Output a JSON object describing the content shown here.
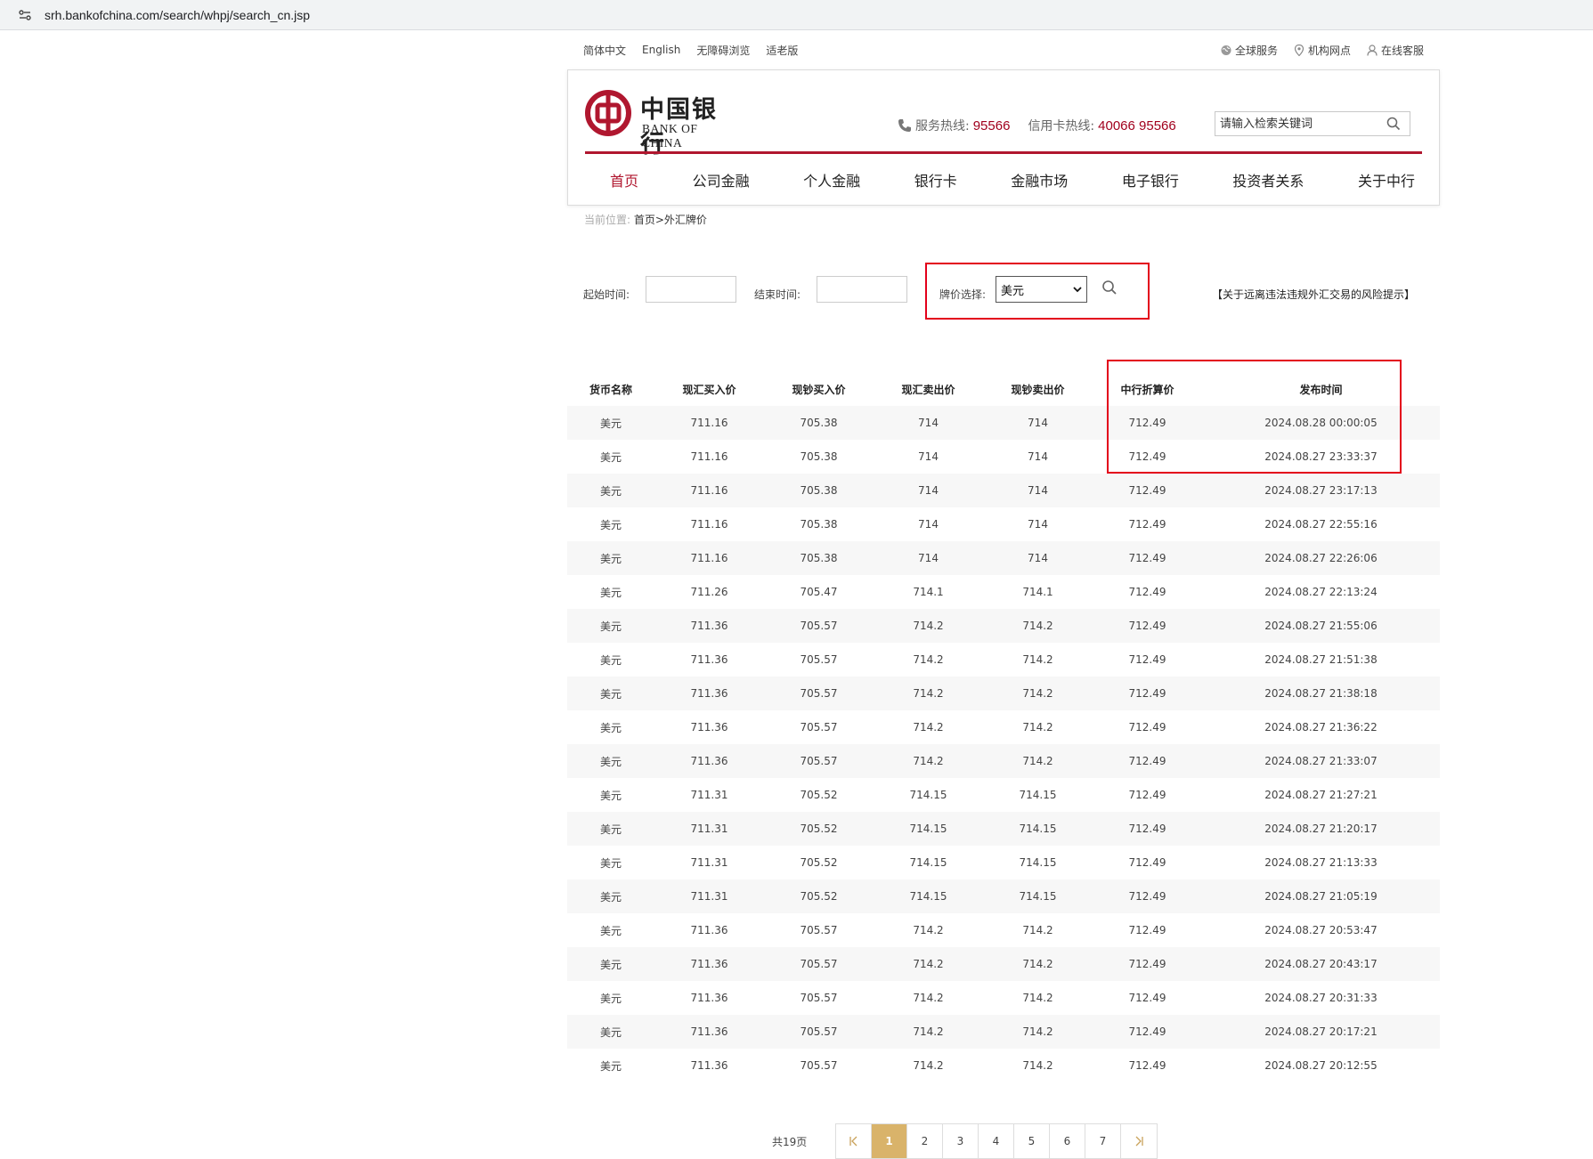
{
  "browser": {
    "url": "srh.bankofchina.com/search/whpj/search_cn.jsp"
  },
  "topbar": {
    "left": [
      "简体中文",
      "English",
      "无障碍浏览",
      "适老版"
    ],
    "global": "全球服务",
    "branches": "机构网点",
    "service": "在线客服"
  },
  "header": {
    "logo_cn": "中国银行",
    "logo_en": "BANK OF CHINA",
    "hotline_label": "服务热线:",
    "hotline": "95566",
    "credit_label": "信用卡热线:",
    "credit": "40066 95566",
    "search_placeholder": "请输入检索关键词",
    "brand_color": "#b0172f"
  },
  "nav": [
    "首页",
    "公司金融",
    "个人金融",
    "银行卡",
    "金融市场",
    "电子银行",
    "投资者关系",
    "关于中行"
  ],
  "breadcrumb": {
    "label": "当前位置:",
    "path": "首页>外汇牌价"
  },
  "filter": {
    "start_label": "起始时间:",
    "end_label": "结束时间:",
    "currency_label": "牌价选择:",
    "currency_value": "美元",
    "risk_notice": "【关于远离违法违规外汇交易的风险提示】"
  },
  "table": {
    "headers": [
      "货币名称",
      "现汇买入价",
      "现钞买入价",
      "现汇卖出价",
      "现钞卖出价",
      "中行折算价",
      "发布时间"
    ],
    "rows": [
      [
        "美元",
        "711.16",
        "705.38",
        "714",
        "714",
        "712.49",
        "2024.08.28 00:00:05"
      ],
      [
        "美元",
        "711.16",
        "705.38",
        "714",
        "714",
        "712.49",
        "2024.08.27 23:33:37"
      ],
      [
        "美元",
        "711.16",
        "705.38",
        "714",
        "714",
        "712.49",
        "2024.08.27 23:17:13"
      ],
      [
        "美元",
        "711.16",
        "705.38",
        "714",
        "714",
        "712.49",
        "2024.08.27 22:55:16"
      ],
      [
        "美元",
        "711.16",
        "705.38",
        "714",
        "714",
        "712.49",
        "2024.08.27 22:26:06"
      ],
      [
        "美元",
        "711.26",
        "705.47",
        "714.1",
        "714.1",
        "712.49",
        "2024.08.27 22:13:24"
      ],
      [
        "美元",
        "711.36",
        "705.57",
        "714.2",
        "714.2",
        "712.49",
        "2024.08.27 21:55:06"
      ],
      [
        "美元",
        "711.36",
        "705.57",
        "714.2",
        "714.2",
        "712.49",
        "2024.08.27 21:51:38"
      ],
      [
        "美元",
        "711.36",
        "705.57",
        "714.2",
        "714.2",
        "712.49",
        "2024.08.27 21:38:18"
      ],
      [
        "美元",
        "711.36",
        "705.57",
        "714.2",
        "714.2",
        "712.49",
        "2024.08.27 21:36:22"
      ],
      [
        "美元",
        "711.36",
        "705.57",
        "714.2",
        "714.2",
        "712.49",
        "2024.08.27 21:33:07"
      ],
      [
        "美元",
        "711.31",
        "705.52",
        "714.15",
        "714.15",
        "712.49",
        "2024.08.27 21:27:21"
      ],
      [
        "美元",
        "711.31",
        "705.52",
        "714.15",
        "714.15",
        "712.49",
        "2024.08.27 21:20:17"
      ],
      [
        "美元",
        "711.31",
        "705.52",
        "714.15",
        "714.15",
        "712.49",
        "2024.08.27 21:13:33"
      ],
      [
        "美元",
        "711.31",
        "705.52",
        "714.15",
        "714.15",
        "712.49",
        "2024.08.27 21:05:19"
      ],
      [
        "美元",
        "711.36",
        "705.57",
        "714.2",
        "714.2",
        "712.49",
        "2024.08.27 20:53:47"
      ],
      [
        "美元",
        "711.36",
        "705.57",
        "714.2",
        "714.2",
        "712.49",
        "2024.08.27 20:43:17"
      ],
      [
        "美元",
        "711.36",
        "705.57",
        "714.2",
        "714.2",
        "712.49",
        "2024.08.27 20:31:33"
      ],
      [
        "美元",
        "711.36",
        "705.57",
        "714.2",
        "714.2",
        "712.49",
        "2024.08.27 20:17:21"
      ],
      [
        "美元",
        "711.36",
        "705.57",
        "714.2",
        "714.2",
        "712.49",
        "2024.08.27 20:12:55"
      ]
    ]
  },
  "pager": {
    "total": "共19页",
    "first": "|<",
    "last": ">|",
    "pages": [
      "1",
      "2",
      "3",
      "4",
      "5",
      "6",
      "7"
    ],
    "active_color": "#d9b36a"
  },
  "highlight_color": "#e3001b"
}
